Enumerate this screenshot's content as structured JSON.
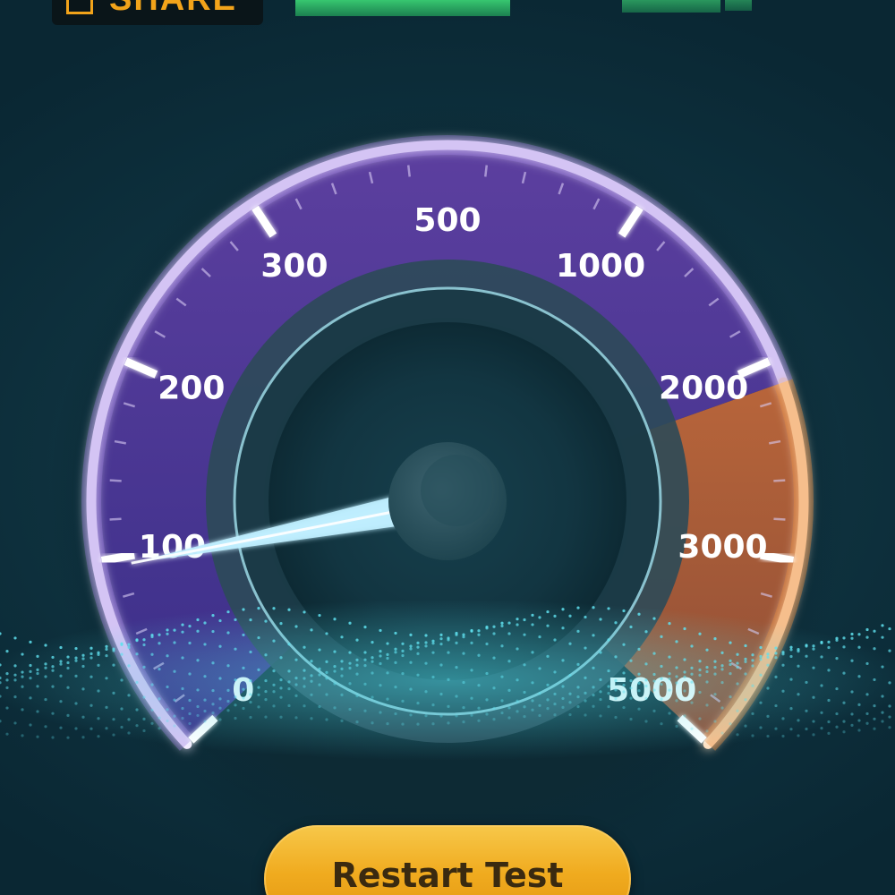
{
  "top_bar": {
    "share_label": "SHARE",
    "share_icon": "share-icon"
  },
  "speedometer": {
    "scale_labels": [
      "0",
      "100",
      "200",
      "300",
      "500",
      "1000",
      "2000",
      "3000",
      "5000"
    ],
    "needle_reading": 0.12,
    "colors": {
      "purple_arc": "#5a3fa6",
      "orange_arc": "#e07b2c",
      "glow": "#e8d8ff",
      "needle": "#bfefff"
    }
  },
  "actions": {
    "restart_label": "Restart Test"
  }
}
